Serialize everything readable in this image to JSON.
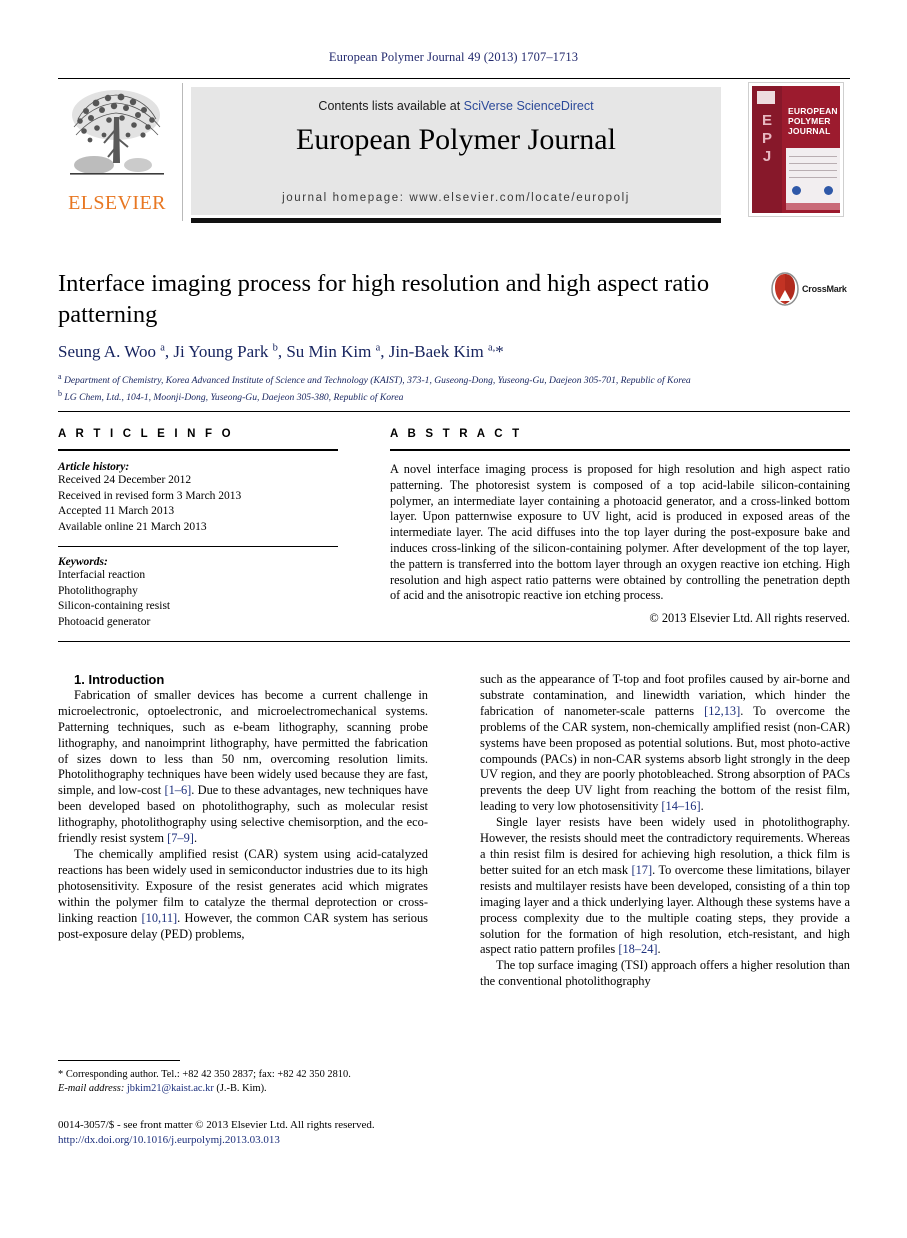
{
  "running_head": "European Polymer Journal 49 (2013) 1707–1713",
  "masthead": {
    "publisher_name": "ELSEVIER",
    "contents_prefix": "Contents lists available at ",
    "contents_link": "SciVerse ScienceDirect",
    "journal_title": "European Polymer Journal",
    "homepage": "journal homepage: www.elsevier.com/locate/europolj",
    "cover": {
      "epj_letters": "E\nP\nJ",
      "cover_title": "EUROPEAN POLYMER JOURNAL"
    }
  },
  "article": {
    "title": "Interface imaging process for high resolution and high aspect ratio patterning",
    "crossmark_label": "CrossMark",
    "authors_html": "Seung A. Woo <sup>a</sup>, Ji Young Park <sup>b</sup>, Su Min Kim <sup>a</sup>, Jin-Baek Kim <sup>a,</sup>*",
    "affiliation_a": "Department of Chemistry, Korea Advanced Institute of Science and Technology (KAIST), 373-1, Guseong-Dong, Yuseong-Gu, Daejeon 305-701, Republic of Korea",
    "affiliation_b": "LG Chem, Ltd., 104-1, Moonji-Dong, Yuseong-Gu, Daejeon 305-380, Republic of Korea"
  },
  "article_info": {
    "heading": "A R T I C L E   I N F O",
    "history_label": "Article history:",
    "history": [
      "Received 24 December 2012",
      "Received in revised form 3 March 2013",
      "Accepted 11 March 2013",
      "Available online 21 March 2013"
    ],
    "keywords_label": "Keywords:",
    "keywords": [
      "Interfacial reaction",
      "Photolithography",
      "Silicon-containing resist",
      "Photoacid generator"
    ]
  },
  "abstract": {
    "heading": "A B S T R A C T",
    "text": "A novel interface imaging process is proposed for high resolution and high aspect ratio patterning. The photoresist system is composed of a top acid-labile silicon-containing polymer, an intermediate layer containing a photoacid generator, and a cross-linked bottom layer. Upon patternwise exposure to UV light, acid is produced in exposed areas of the intermediate layer. The acid diffuses into the top layer during the post-exposure bake and induces cross-linking of the silicon-containing polymer. After development of the top layer, the pattern is transferred into the bottom layer through an oxygen reactive ion etching. High resolution and high aspect ratio patterns were obtained by controlling the penetration depth of acid and the anisotropic reactive ion etching process.",
    "copyright": "© 2013 Elsevier Ltd. All rights reserved."
  },
  "body": {
    "section_title": "1. Introduction",
    "left_paragraphs": [
      "Fabrication of smaller devices has become a current challenge in microelectronic, optoelectronic, and microelectromechanical systems. Patterning techniques, such as e-beam lithography, scanning probe lithography, and nanoimprint lithography, have permitted the fabrication of sizes down to less than 50 nm, overcoming resolution limits. Photolithography techniques have been widely used because they are fast, simple, and low-cost [1–6]. Due to these advantages, new techniques have been developed based on photolithography, such as molecular resist lithography, photolithography using selective chemisorption, and the eco-friendly resist system [7–9].",
      "The chemically amplified resist (CAR) system using acid-catalyzed reactions has been widely used in semiconductor industries due to its high photosensitivity. Exposure of the resist generates acid which migrates within the polymer film to catalyze the thermal deprotection or cross-linking reaction [10,11]. However, the common CAR system has serious post-exposure delay (PED) problems,"
    ],
    "right_paragraphs": [
      "such as the appearance of T-top and foot profiles caused by air-borne and substrate contamination, and linewidth variation, which hinder the fabrication of nanometer-scale patterns [12,13]. To overcome the problems of the CAR system, non-chemically amplified resist (non-CAR) systems have been proposed as potential solutions. But, most photo-active compounds (PACs) in non-CAR systems absorb light strongly in the deep UV region, and they are poorly photobleached. Strong absorption of PACs prevents the deep UV light from reaching the bottom of the resist film, leading to very low photosensitivity [14–16].",
      "Single layer resists have been widely used in photolithography. However, the resists should meet the contradictory requirements. Whereas a thin resist film is desired for achieving high resolution, a thick film is better suited for an etch mask [17]. To overcome these limitations, bilayer resists and multilayer resists have been developed, consisting of a thin top imaging layer and a thick underlying layer. Although these systems have a process complexity due to the multiple coating steps, they provide a solution for the formation of high resolution, etch-resistant, and high aspect ratio pattern profiles [18–24].",
      "The top surface imaging (TSI) approach offers a higher resolution than the conventional photolithography"
    ]
  },
  "footnote": {
    "marker": "*",
    "line1": "Corresponding author. Tel.: +82 42 350 2837; fax: +82 42 350 2810.",
    "email_label": "E-mail address:",
    "email": "jbkim21@kaist.ac.kr",
    "email_suffix": "(J.-B. Kim)."
  },
  "page_footer": {
    "issn_line": "0014-3057/$ - see front matter © 2013 Elsevier Ltd. All rights reserved.",
    "doi": "http://dx.doi.org/10.1016/j.eurpolymj.2013.03.013"
  },
  "colors": {
    "link_blue": "#1c2f7c",
    "elsevier_orange": "#e87722",
    "cover_red": "#9c1b2e",
    "band_grey": "#e6e6e6"
  }
}
